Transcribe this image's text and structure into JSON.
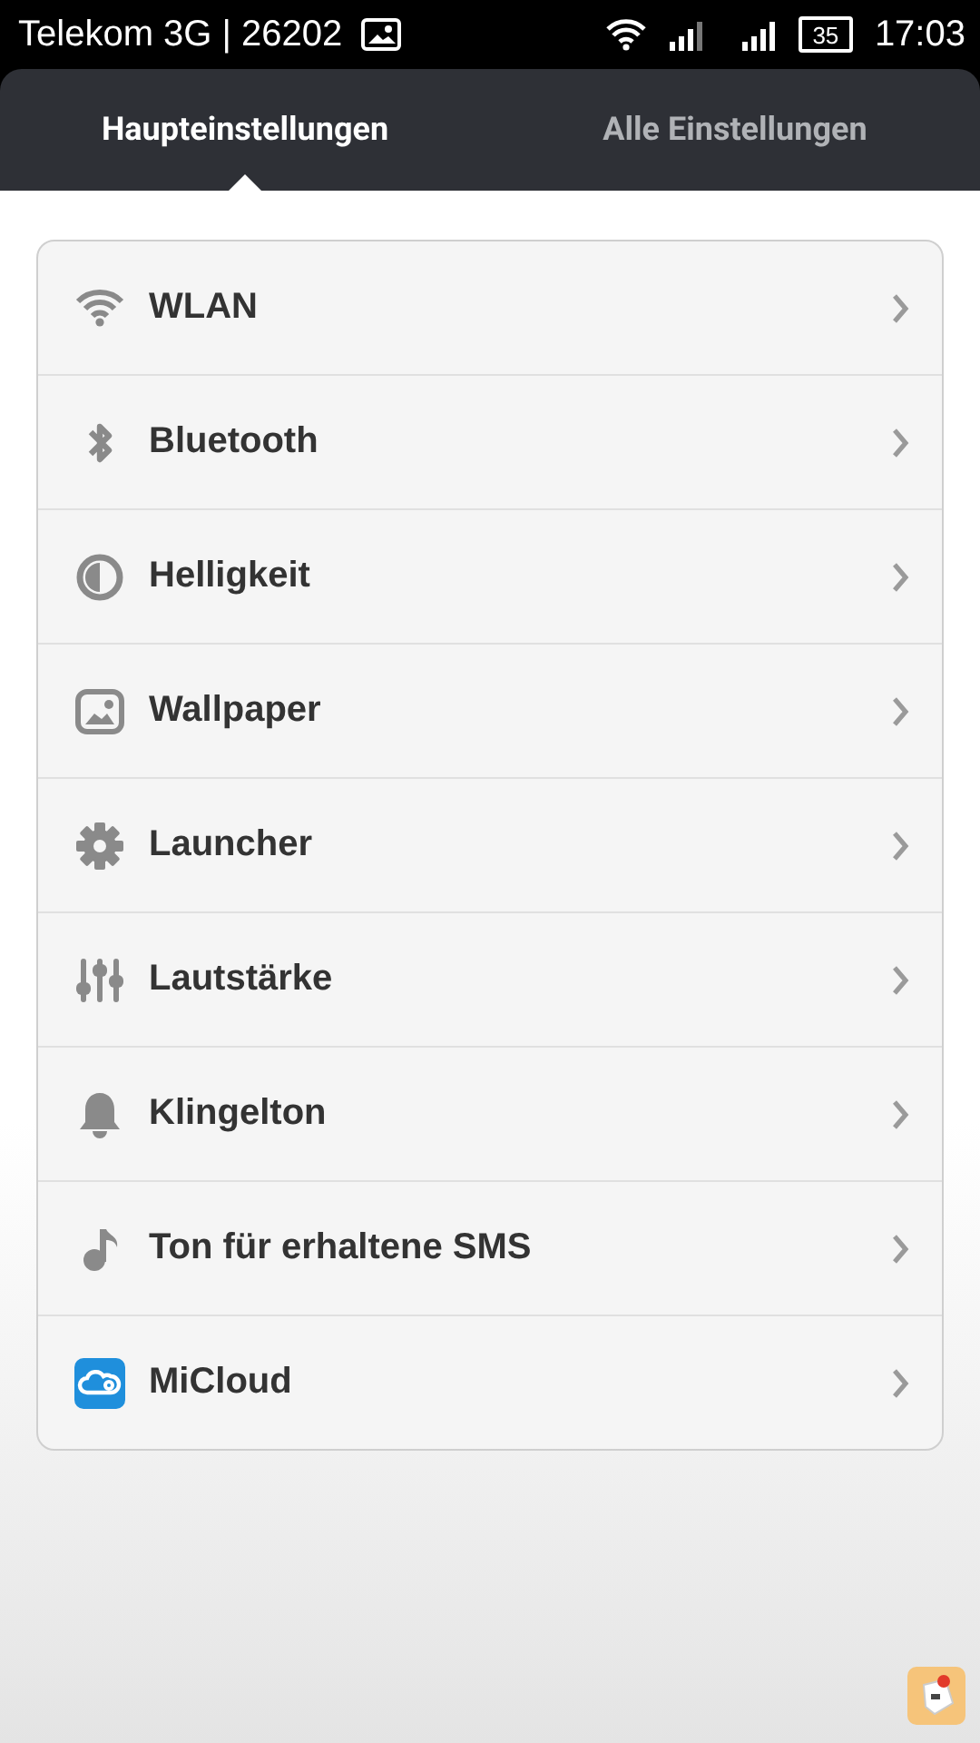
{
  "status_bar": {
    "carrier": "Telekom 3G | 26202",
    "battery": "35",
    "time": "17:03"
  },
  "tabs": [
    {
      "label": "Haupteinstellungen",
      "selected": true
    },
    {
      "label": "Alle Einstellungen",
      "selected": false
    }
  ],
  "settings": [
    {
      "kind": "wifi",
      "label": "WLAN"
    },
    {
      "kind": "bluetooth",
      "label": "Bluetooth"
    },
    {
      "kind": "brightness",
      "label": "Helligkeit"
    },
    {
      "kind": "wallpaper",
      "label": "Wallpaper"
    },
    {
      "kind": "gear",
      "label": "Launcher"
    },
    {
      "kind": "sliders",
      "label": "Lautstärke"
    },
    {
      "kind": "bell",
      "label": "Klingelton"
    },
    {
      "kind": "note",
      "label": "Ton für erhaltene SMS"
    },
    {
      "kind": "cloud",
      "label": "MiCloud"
    }
  ]
}
